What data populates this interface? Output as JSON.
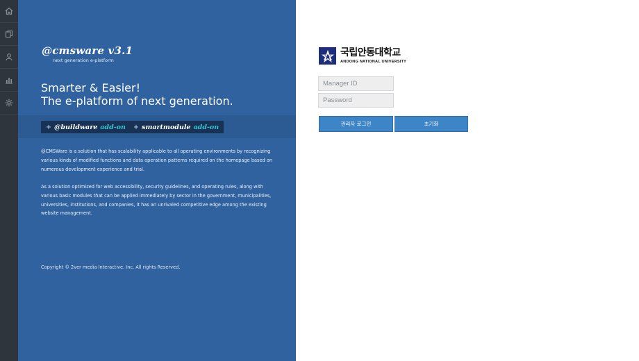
{
  "sidebar": {
    "items": [
      {
        "icon": "home-icon"
      },
      {
        "icon": "copy-icon"
      },
      {
        "icon": "user-icon"
      },
      {
        "icon": "chart-icon"
      },
      {
        "icon": "gear-icon"
      }
    ]
  },
  "brand": {
    "logo": "@cmsware v3.1",
    "tagline": "next generation e-platform",
    "headline_1": "Smarter & Easier!",
    "headline_2": "The e-platform of next generation."
  },
  "addons": [
    {
      "plus": "+",
      "name": "@buildware",
      "tag": "add-on"
    },
    {
      "plus": "+",
      "name": "smartmodule",
      "tag": "add-on"
    }
  ],
  "description": {
    "para_1": "@CMSWare is a solution that has scalability applicable to all operating environments by recognizing various kinds of modified functions and data operation patterns required on the homepage based on numerous development experience and trial.",
    "para_2": "As a solution optimized for web accessibility, security guidelines, and operating rules, along with various basic modules that can be applied immediately by sector in the government, municipalities, universities, institutions, and companies, it has an unrivaled competitive edge among the existing website management."
  },
  "copyright": "Copyright © 2ver media Interactive. Inc. All rights Reserved.",
  "university": {
    "name_kr": "국립안동대학교",
    "name_en": "ANDONG NATIONAL UNIVERSITY"
  },
  "login": {
    "id_placeholder": "Manager ID",
    "id_value": "",
    "pw_placeholder": "Password",
    "pw_value": "",
    "login_label": "관리자 로그인",
    "reset_label": "초기화"
  },
  "colors": {
    "rail": "#2f353c",
    "panel": "#30629f",
    "addon_bg": "#173254",
    "addon_accent": "#36c3d6",
    "button": "#3d85c6"
  }
}
